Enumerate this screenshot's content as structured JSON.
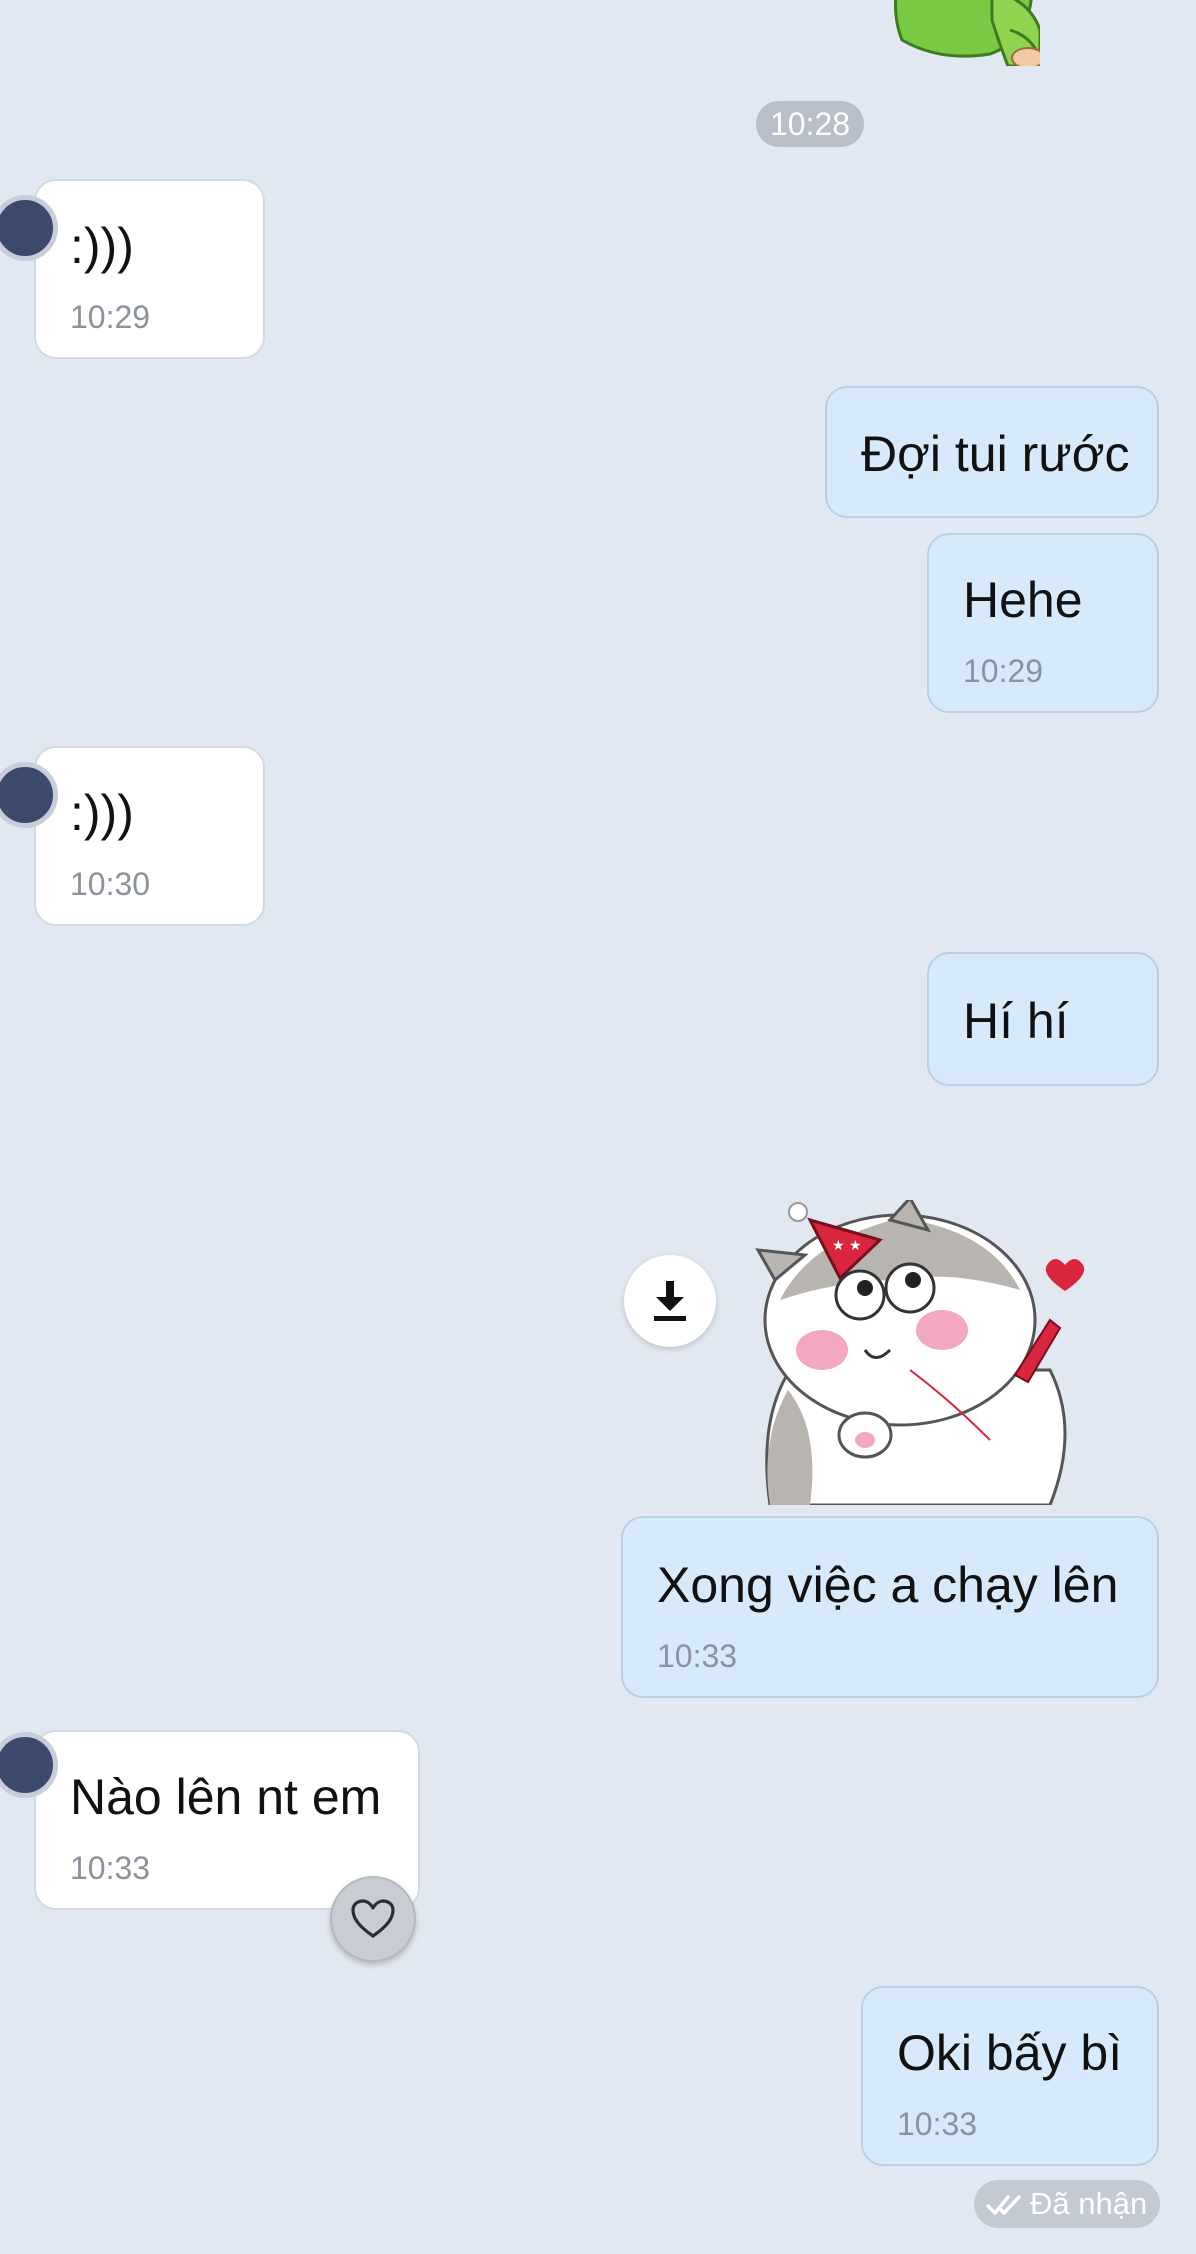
{
  "time_separator": "10:28",
  "messages": [
    {
      "direction": "incoming",
      "text": ":)))",
      "time": "10:29"
    },
    {
      "direction": "outgoing",
      "text": "Đợi tui rước"
    },
    {
      "direction": "outgoing",
      "text": "Hehe",
      "time": "10:29"
    },
    {
      "direction": "incoming",
      "text": ":)))",
      "time": "10:30"
    },
    {
      "direction": "outgoing",
      "text": "Hí hí"
    },
    {
      "direction": "outgoing",
      "text": "Xong việc a chạy lên",
      "time": "10:33"
    },
    {
      "direction": "incoming",
      "text": "Nào lên nt em",
      "time": "10:33"
    },
    {
      "direction": "outgoing",
      "text": "Oki bấy bì",
      "time": "10:33"
    }
  ],
  "status": {
    "label": "Đã nhận",
    "icon": "double-check-icon"
  },
  "icons": {
    "download": "download-icon",
    "heart": "heart-icon",
    "sticker_top": "sticker-image",
    "sticker_cat": "cat-sticker-image"
  },
  "colors": {
    "background": "#e2e8f1",
    "incoming_bubble": "#ffffff",
    "outgoing_bubble": "#d6eafb",
    "time_text": "#8b929b"
  }
}
